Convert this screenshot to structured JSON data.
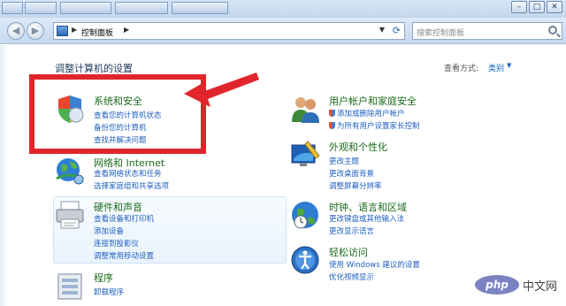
{
  "address_bar": {
    "breadcrumb": "控制面板",
    "search_placeholder": "搜索控制面板"
  },
  "window_buttons": [
    "–",
    "□",
    "✕"
  ],
  "page_title": "调整计算机的设置",
  "view_by": {
    "label": "查看方式:",
    "value": "类别",
    "dropdown": "▼"
  },
  "categories": {
    "system_security": {
      "title": "系统和安全",
      "links": [
        "查看您的计算机状态",
        "备份您的计算机",
        "查找并解决问题"
      ]
    },
    "network": {
      "title": "网络和 Internet",
      "links": [
        "查看网络状态和任务",
        "选择家庭组和共享选项"
      ]
    },
    "hardware": {
      "title": "硬件和声音",
      "links": [
        "查看设备和打印机",
        "添加设备",
        "连接到投影仪",
        "调整常用移动设置"
      ]
    },
    "programs": {
      "title": "程序",
      "links": [
        "卸载程序"
      ]
    },
    "user_accounts": {
      "title": "用户帐户和家庭安全",
      "links": [
        "添加或删除用户帐户",
        "为所有用户设置家长控制"
      ]
    },
    "appearance": {
      "title": "外观和个性化",
      "links": [
        "更改主题",
        "更改桌面背景",
        "调整屏幕分辨率"
      ]
    },
    "clock": {
      "title": "时钟、语言和区域",
      "links": [
        "更改键盘或其他输入法",
        "更改显示语言"
      ]
    },
    "ease": {
      "title": "轻松访问",
      "links": [
        "使用 Windows 建议的设置",
        "优化视频显示"
      ]
    }
  },
  "watermark": {
    "logo": "php",
    "text": "中文网"
  },
  "colors": {
    "category_title": "#1b6b1b",
    "link": "#1f5fbf",
    "annotation_red": "#e0262b"
  }
}
